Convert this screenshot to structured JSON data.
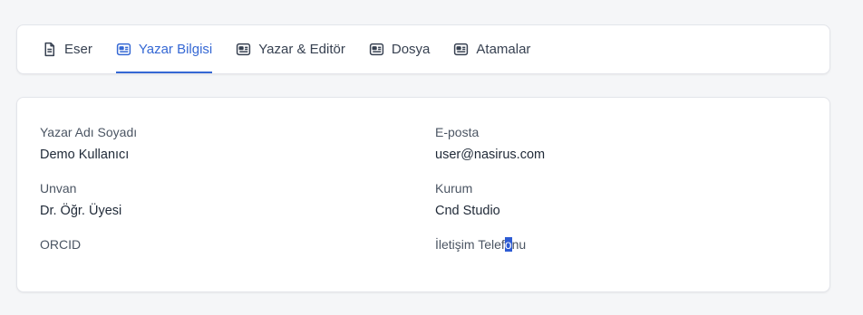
{
  "tabs": [
    {
      "label": "Eser",
      "icon": "document-icon",
      "active": false
    },
    {
      "label": "Yazar Bilgisi",
      "icon": "id-card-icon",
      "active": true
    },
    {
      "label": "Yazar & Editör",
      "icon": "id-card-icon",
      "active": false
    },
    {
      "label": "Dosya",
      "icon": "id-card-icon",
      "active": false
    },
    {
      "label": "Atamalar",
      "icon": "id-card-icon",
      "active": false
    }
  ],
  "fields": {
    "author_name": {
      "label": "Yazar Adı Soyadı",
      "value": "Demo Kullanıcı"
    },
    "email": {
      "label": "E-posta",
      "value": "user@nasirus.com"
    },
    "title": {
      "label": "Unvan",
      "value": "Dr. Öğr. Üyesi"
    },
    "institution": {
      "label": "Kurum",
      "value": "Cnd Studio"
    },
    "orcid": {
      "label": "ORCID",
      "value": ""
    },
    "phone": {
      "label_before": "İletişim Telef",
      "label_selected": "o",
      "label_after": "nu",
      "value": ""
    }
  },
  "colors": {
    "accent": "#3568d4",
    "background": "#f5f6f8",
    "selection": "#2d5bd3"
  }
}
